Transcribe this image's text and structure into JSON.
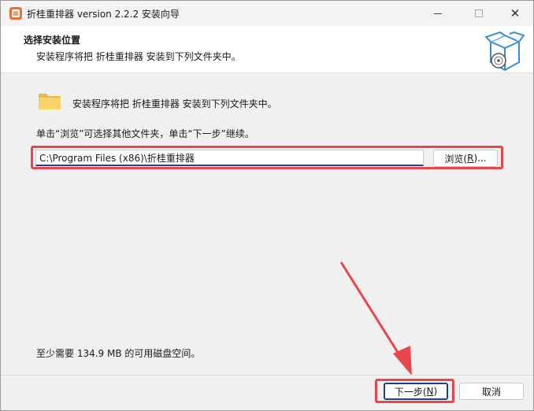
{
  "window": {
    "title": "折桂重排器 version 2.2.2 安装向导",
    "minimize": "—",
    "maximize": "☐",
    "close": "✕"
  },
  "header": {
    "title": "选择安装位置",
    "subtitle": "安装程序将把 折桂重排器 安装到下列文件夹中。"
  },
  "body": {
    "folder_text": "安装程序将把 折桂重排器 安装到下列文件夹中。",
    "hint_text": "单击“浏览”可选择其他文件夹，单击“下一步”继续。",
    "install_path": "C:\\Program Files (x86)\\折桂重排器",
    "browse_label": "浏览(",
    "browse_key": "R",
    "browse_suffix": ")...",
    "space_text": "至少需要 134.9 MB 的可用磁盘空间。"
  },
  "footer": {
    "next_label": "下一步(",
    "next_key": "N",
    "next_suffix": ")",
    "cancel_label": "取消"
  },
  "colors": {
    "highlight": "#e8464c",
    "accent": "#1f3f8c"
  }
}
